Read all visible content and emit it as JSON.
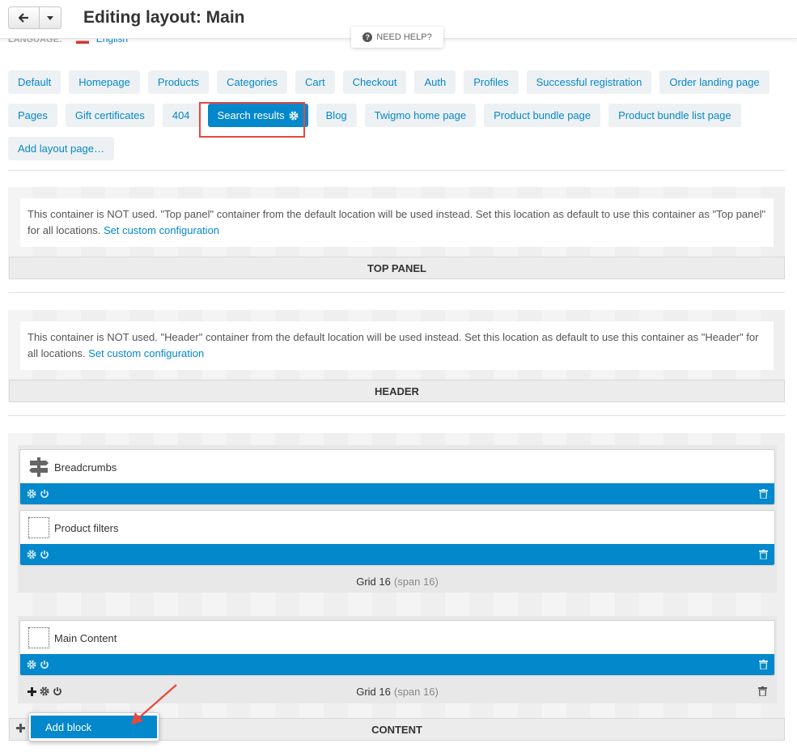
{
  "header": {
    "title": "Editing layout: Main",
    "language_label": "LANGUAGE:",
    "language_value": "English",
    "need_help": "NEED HELP?"
  },
  "tabs": [
    {
      "label": "Default"
    },
    {
      "label": "Homepage"
    },
    {
      "label": "Products"
    },
    {
      "label": "Categories"
    },
    {
      "label": "Cart"
    },
    {
      "label": "Checkout"
    },
    {
      "label": "Auth"
    },
    {
      "label": "Profiles"
    },
    {
      "label": "Successful registration"
    },
    {
      "label": "Order landing page"
    },
    {
      "label": "Pages"
    },
    {
      "label": "Gift certificates"
    },
    {
      "label": "404"
    },
    {
      "label": "Search results",
      "active": true
    },
    {
      "label": "Blog"
    },
    {
      "label": "Twigmo home page"
    },
    {
      "label": "Product bundle page"
    },
    {
      "label": "Product bundle list page"
    },
    {
      "label": "Add layout page…"
    }
  ],
  "top_panel": {
    "notice": "This container is NOT used. \"Top panel\" container from the default location will be used instead. Set this location as default to use this container as \"Top panel\" for all locations.",
    "link": "Set custom configuration",
    "label": "TOP PANEL"
  },
  "header_container": {
    "notice": "This container is NOT used. \"Header\" container from the default location will be used instead. Set this location as default to use this container as \"Header\" for all locations.",
    "link": "Set custom configuration",
    "label": "HEADER"
  },
  "content": {
    "label": "CONTENT",
    "grids": [
      {
        "title": "Grid 16",
        "span": "(span 16)",
        "blocks": [
          {
            "name": "Breadcrumbs",
            "icon": "signpost-icon"
          },
          {
            "name": "Product filters",
            "icon": "placeholder-icon"
          }
        ]
      },
      {
        "title": "Grid 16",
        "span": "(span 16)",
        "blocks": [
          {
            "name": "Main Content",
            "icon": "placeholder-icon"
          }
        ]
      }
    ],
    "add_block": "Add block"
  },
  "colors": {
    "accent": "#0388cc",
    "highlight": "#e8473e"
  }
}
